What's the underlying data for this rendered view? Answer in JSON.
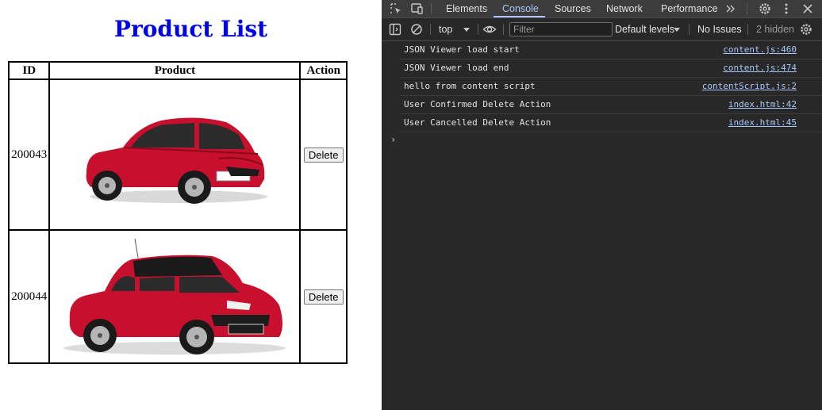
{
  "page": {
    "title": "Product List",
    "table": {
      "headers": {
        "id": "ID",
        "product": "Product",
        "action": "Action"
      },
      "rows": [
        {
          "id": "200043",
          "product_image": "red-hyundai-grand-i10-nios",
          "action_label": "Delete"
        },
        {
          "id": "200044",
          "product_image": "red-suzuki-swift",
          "action_label": "Delete"
        }
      ]
    }
  },
  "devtools": {
    "tabs": [
      "Elements",
      "Console",
      "Sources",
      "Network",
      "Performance"
    ],
    "active_tab": "Console",
    "toolbar": {
      "context": "top",
      "filter_placeholder": "Filter",
      "levels": "Default levels",
      "issues": "No Issues",
      "hidden": "2 hidden"
    },
    "messages": [
      {
        "text": "JSON Viewer load start",
        "source": "content.js:460"
      },
      {
        "text": "JSON Viewer load end",
        "source": "content.js:474"
      },
      {
        "text": "hello from content script",
        "source": "contentScript.js:2"
      },
      {
        "text": "User Confirmed Delete Action",
        "source": "index.html:42"
      },
      {
        "text": "User Cancelled Delete Action",
        "source": "index.html:45"
      }
    ],
    "prompt_symbol": "›"
  },
  "colors": {
    "title": "#0000e6",
    "devtools_bg": "#282828",
    "link": "#a8c7fa",
    "car_red": "#c8102e"
  },
  "icons": [
    "inspect-icon",
    "device-toggle-icon",
    "more-tabs-icon",
    "settings-icon",
    "kebab-menu-icon",
    "close-icon",
    "sidebar-toggle-icon",
    "clear-console-icon",
    "eye-icon",
    "dropdown-arrow-icon",
    "hidden-settings-icon"
  ]
}
